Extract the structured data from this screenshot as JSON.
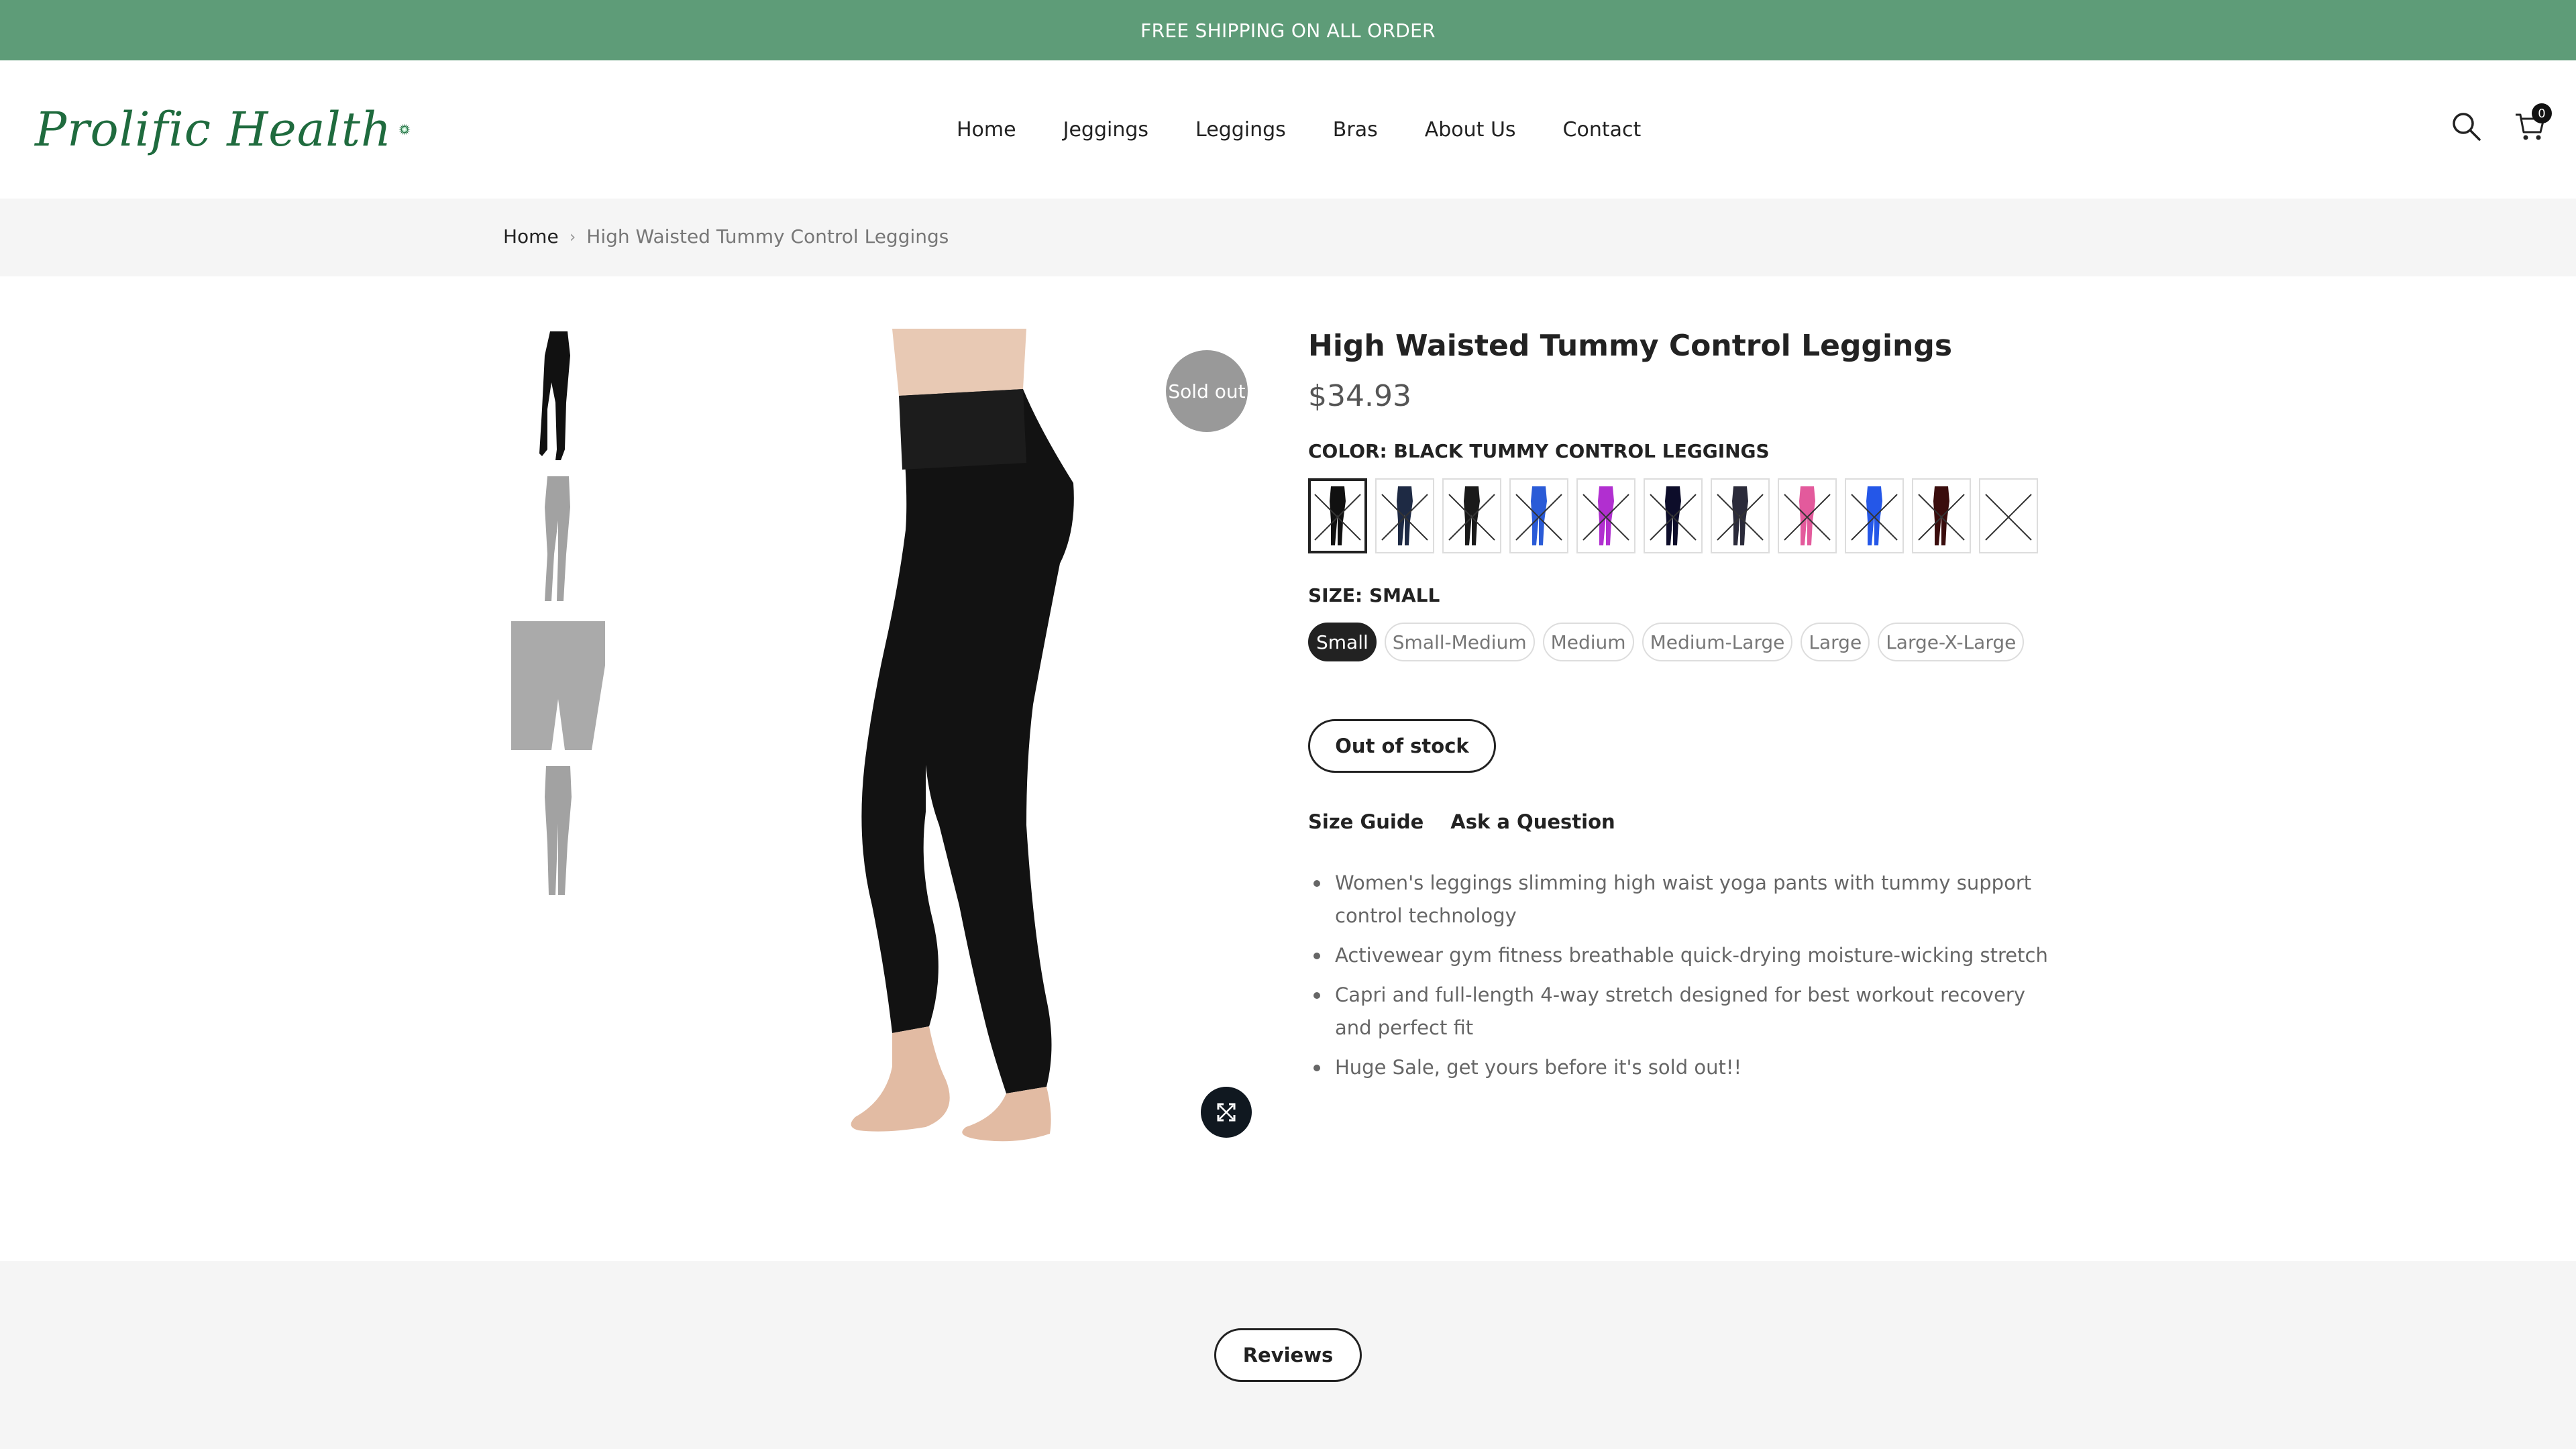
{
  "announcement": "FREE SHIPPING ON ALL ORDER",
  "brand": {
    "name": "Prolific Health"
  },
  "nav": [
    "Home",
    "Jeggings",
    "Leggings",
    "Bras",
    "About Us",
    "Contact"
  ],
  "header_icons": {
    "search": "search-icon",
    "cart": "cart-icon",
    "cart_count": "0"
  },
  "breadcrumb": {
    "home": "Home",
    "separator": "›",
    "current": "High Waisted Tummy Control Leggings"
  },
  "product": {
    "badge": "Sold out",
    "title": "High Waisted Tummy Control Leggings",
    "price": "$34.93",
    "color_label": "COLOR: BLACK TUMMY CONTROL LEGGINGS",
    "swatch_colors": [
      "#111111",
      "#1e2a44",
      "#1a1a1a",
      "#2a5bd7",
      "#b12fd0",
      "#0d0d2a",
      "#2b2b3a",
      "#e35a9c",
      "#2457e8",
      "#3a0d0d",
      "#e0e0e0"
    ],
    "size_label": "SIZE: SMALL",
    "sizes": [
      "Small",
      "Small-Medium",
      "Medium",
      "Medium-Large",
      "Large",
      "Large-X-Large"
    ],
    "selected_size": "Small",
    "stock_button": "Out of stock",
    "links": {
      "size_guide": "Size Guide",
      "ask": "Ask a Question"
    },
    "bullets": [
      "Women's leggings slimming high waist yoga pants with tummy support control technology",
      "Activewear gym fitness breathable quick-drying moisture-wicking stretch",
      "Capri and full-length 4-way stretch designed for best workout recovery and perfect fit",
      "Huge Sale, get yours before it's sold out!!"
    ]
  },
  "reviews_button": "Reviews",
  "colors": {
    "topbar": "#5e9c78",
    "brand_green": "#1f6b3e",
    "dark": "#222222"
  }
}
